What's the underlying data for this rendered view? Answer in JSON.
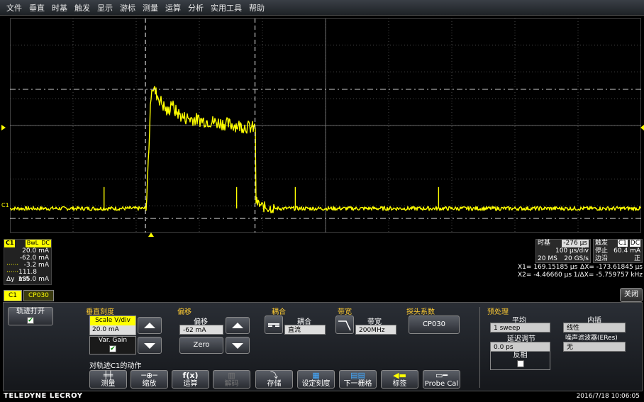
{
  "menu": [
    "文件",
    "垂直",
    "时基",
    "触发",
    "显示",
    "游标",
    "测量",
    "运算",
    "分析",
    "实用工具",
    "帮助"
  ],
  "colors": {
    "trace": "#ffff00",
    "grid": "#6a6a6a",
    "accent": "#ffcc33",
    "cursor": "#ffffff"
  },
  "channel_marker": "C1",
  "waveform": {
    "baseline_current_mA": -62.0,
    "peak_current_mA": 30.0,
    "plateau_current_mA": 6.0,
    "cursor1_us": 169.15185,
    "cursor2_us": -4.4666,
    "h_center_us": 0
  },
  "info_c1": {
    "label": "C1",
    "badges": [
      "BwL",
      "DC"
    ],
    "rows": [
      {
        "k": "",
        "v": "20.0 mA"
      },
      {
        "k": "",
        "v": "-62.0 mA"
      },
      {
        "k": "",
        "v": "-3.2 mA"
      },
      {
        "k": "",
        "v": "111.8 mA"
      },
      {
        "k": "Δy",
        "v": "135.0 mA"
      }
    ]
  },
  "timebase": {
    "title": "时基",
    "offset": "-276 µs",
    "div": "100 µs/div",
    "sr_left": "20 MS",
    "sr_right": "20 GS/s"
  },
  "trigger": {
    "title": "触发",
    "badge1": "C1",
    "badge2": "DC",
    "mode": "停止",
    "level": "60.4 mA",
    "type": "边沿",
    "slope": "正"
  },
  "cursors": {
    "x1_label": "X1=",
    "x1": "169.15185 µs",
    "dx_label": "ΔX=",
    "dx": "-173.61845 µs",
    "x2_label": "X2=",
    "x2": "-4.46660 µs",
    "inv_label": "1/ΔX=",
    "inv": "-5.759757 kHz"
  },
  "tabs": [
    "C1",
    "CP030"
  ],
  "close_label": "关闭",
  "panel": {
    "trace_on": "轨迹打开",
    "vscale_title": "垂直刻度",
    "scale_label": "Scale V/div",
    "scale_value": "20.0 mA",
    "var_gain": "Var. Gain",
    "offset_title": "偏移",
    "offset_label": "偏移",
    "offset_value": "-62 mA",
    "zero": "Zero",
    "coupling_title": "耦合",
    "coupling_label": "耦合",
    "coupling_value": "直流",
    "bw_title": "带宽",
    "bw_label": "带宽",
    "bw_value": "200MHz",
    "probe_title": "探头系数",
    "probe_value": "CP030",
    "preproc_title": "预处理",
    "avg_label": "平均",
    "avg_value": "1 sweep",
    "interp_label": "内插",
    "interp_value": "线性",
    "delay_label": "延迟调节",
    "delay_value": "0.0 ps",
    "noise_label": "噪声滤波器(ERes)",
    "noise_value": "无",
    "invert_label": "反相",
    "actions_title": "对轨迹C1的动作",
    "buttons": [
      "测量",
      "缩放",
      "运算",
      "解码",
      "存储",
      "设定刻度",
      "下一栅格",
      "标签",
      "Probe Cal"
    ],
    "button_icons": [
      "measure-icon",
      "zoom-icon",
      "math-icon",
      "decode-icon",
      "store-icon",
      "rescale-icon",
      "next-grid-icon",
      "label-icon",
      "probe-icon"
    ]
  },
  "footer": {
    "brand": "TELEDYNE LECROY",
    "datetime": "2016/7/18 10:06:05"
  }
}
